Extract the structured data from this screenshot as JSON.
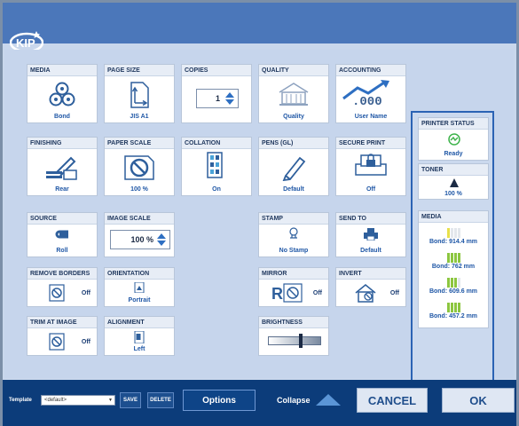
{
  "app": {
    "logo_text": "KIP"
  },
  "cards": {
    "media": {
      "title": "MEDIA",
      "value": "Bond"
    },
    "page_size": {
      "title": "PAGE SIZE",
      "value": "JIS A1"
    },
    "copies": {
      "title": "COPIES",
      "value": "1"
    },
    "quality": {
      "title": "QUALITY",
      "value": "Quality"
    },
    "accounting": {
      "title": "ACCOUNTING",
      "value": "User Name"
    },
    "finishing": {
      "title": "FINISHING",
      "value": "Rear"
    },
    "paper_scale": {
      "title": "PAPER SCALE",
      "value": "100 %"
    },
    "collation": {
      "title": "COLLATION",
      "value": "On"
    },
    "pens": {
      "title": "PENS (GL)",
      "value": "Default"
    },
    "secure_print": {
      "title": "SECURE PRINT",
      "value": "Off"
    },
    "source": {
      "title": "SOURCE",
      "value": "Roll"
    },
    "image_scale": {
      "title": "IMAGE SCALE",
      "value": "100 %"
    },
    "stamp": {
      "title": "STAMP",
      "value": "No Stamp"
    },
    "send_to": {
      "title": "SEND TO",
      "value": "Default"
    },
    "remove_borders": {
      "title": "REMOVE BORDERS",
      "value": "Off"
    },
    "orientation": {
      "title": "ORIENTATION",
      "value": "Portrait"
    },
    "mirror": {
      "title": "MIRROR",
      "value": "Off"
    },
    "invert": {
      "title": "INVERT",
      "value": "Off"
    },
    "trim": {
      "title": "TRIM AT IMAGE",
      "value": "Off"
    },
    "alignment": {
      "title": "ALIGNMENT",
      "value": "Left"
    },
    "brightness": {
      "title": "BRIGHTNESS",
      "level": 0.6
    }
  },
  "status": {
    "printer": {
      "title": "PRINTER STATUS",
      "value": "Ready"
    },
    "toner": {
      "title": "TONER",
      "value": "100 %"
    },
    "media": {
      "title": "MEDIA",
      "rolls": [
        {
          "label": "Bond: 914.4 mm",
          "level": 0.2
        },
        {
          "label": "Bond: 762 mm",
          "level": 1
        },
        {
          "label": "Bond: 609.6 mm",
          "level": 0.7
        },
        {
          "label": "Bond: 457.2 mm",
          "level": 1
        }
      ]
    }
  },
  "footer": {
    "template_label": "Template",
    "template_value": "<default>",
    "save": "SAVE",
    "delete": "DELETE",
    "options": "Options",
    "collapse": "Collapse",
    "cancel": "CANCEL",
    "ok": "OK"
  },
  "colors": {
    "accent": "#1f57a6",
    "header": "#4b77ba",
    "footer": "#0c3c7a",
    "level_yellow": "#e8e04a",
    "level_green": "#8cc63f"
  }
}
